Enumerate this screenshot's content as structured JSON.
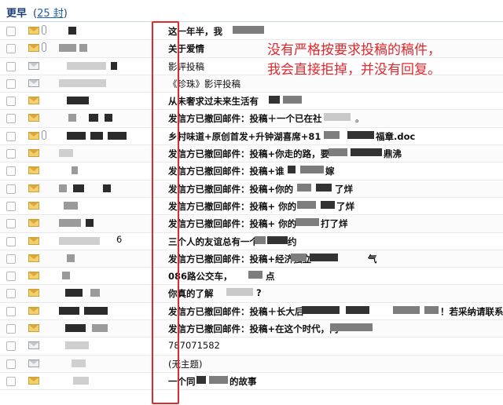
{
  "header": {
    "title": "更早",
    "count": "25 封"
  },
  "note": {
    "line1": "没有严格按要求投稿的稿件，",
    "line2": "我会直接拒掉，并没有回复。"
  },
  "rows": [
    {
      "subject": "这一年半，我"
    },
    {
      "subject": "关于爱情"
    },
    {
      "subject": "影评投稿"
    },
    {
      "subject": "《珍珠》影评投稿"
    },
    {
      "subject": "从未奢求过未来生活有"
    },
    {
      "subject": "发信方已撤回邮件：投稿＋一个已在社"
    },
    {
      "subject": "乡村味道+原创首发+升钟湖喜席+81"
    },
    {
      "subject": "发信方已撤回邮件：投稿+你走的路，要"
    },
    {
      "subject": "发信方已撤回邮件：投稿+谁"
    },
    {
      "subject": "发信方已撤回邮件：投稿+你的"
    },
    {
      "subject": "发信方已撤回邮件：投稿+ 你的"
    },
    {
      "subject": "发信方已撤回邮件：投稿+ 你的"
    },
    {
      "subject": "三个人的友谊总有一个"
    },
    {
      "subject": "发信方已撤回邮件：投稿+经济独立"
    },
    {
      "subject": "086路公交车，"
    },
    {
      "subject": "你真的了解"
    },
    {
      "subject": "发信方已撤回邮件：投稿＋长大后"
    },
    {
      "subject": "发信方已撤回邮件：投稿+在这个时代，内"
    },
    {
      "subject": "787071582"
    },
    {
      "subject": "(无主题)"
    },
    {
      "subject": "一个同"
    }
  ],
  "extra_text": {
    "row1_tail": "福章.doc",
    "row8_tail": "鼎沸",
    "row9_tail": "嫁",
    "row10_tail": "了烊",
    "row11_tail": "了烊",
    "row12_tail": "打了烊",
    "row13_tail": "约",
    "row14_tail": "气",
    "row15_tail": "点",
    "row16_tail": "?",
    "row17_tail": "！若采纳请联系",
    "row21_tail": "的故事",
    "row6_tail": "。",
    "sender_tail_13": "6"
  }
}
